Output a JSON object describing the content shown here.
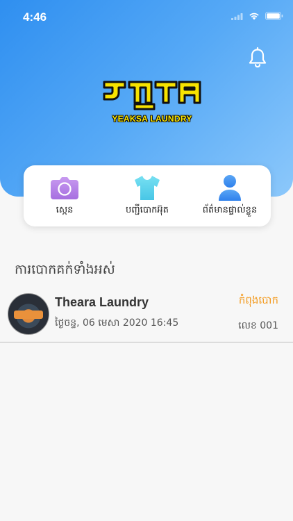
{
  "status_bar": {
    "time": "4:46",
    "icons": [
      "signal-icon",
      "wifi-icon",
      "battery-icon"
    ]
  },
  "header": {
    "notification_icon": "bell-icon"
  },
  "logo": {
    "khmer_text": "យក្សា",
    "english_text": "YEAKSA LAUNDRY"
  },
  "menu": {
    "items": [
      {
        "label": "ស្កេន",
        "icon": "camera-icon",
        "color": "#b783e6"
      },
      {
        "label": "បញ្ជីបោកអ៊ុត",
        "icon": "tshirt-icon",
        "color": "#5fd3ea"
      },
      {
        "label": "ព័ត៌មានផ្ទាល់ខ្លួន",
        "icon": "profile-icon",
        "color": "#3d8ff0"
      }
    ]
  },
  "section": {
    "title": "ការបោកគក់ទាំងអស់"
  },
  "orders": [
    {
      "shop": "Theara Laundry",
      "date": "ថ្ងៃចន្ទ, 06 មេសា 2020 16:45",
      "status": "កំពុងបោក",
      "number": "លេខ 001"
    }
  ],
  "colors": {
    "header_gradient_start": "#2f8ff0",
    "header_gradient_end": "#8cc8fb",
    "status_orange": "#f39a1e"
  }
}
